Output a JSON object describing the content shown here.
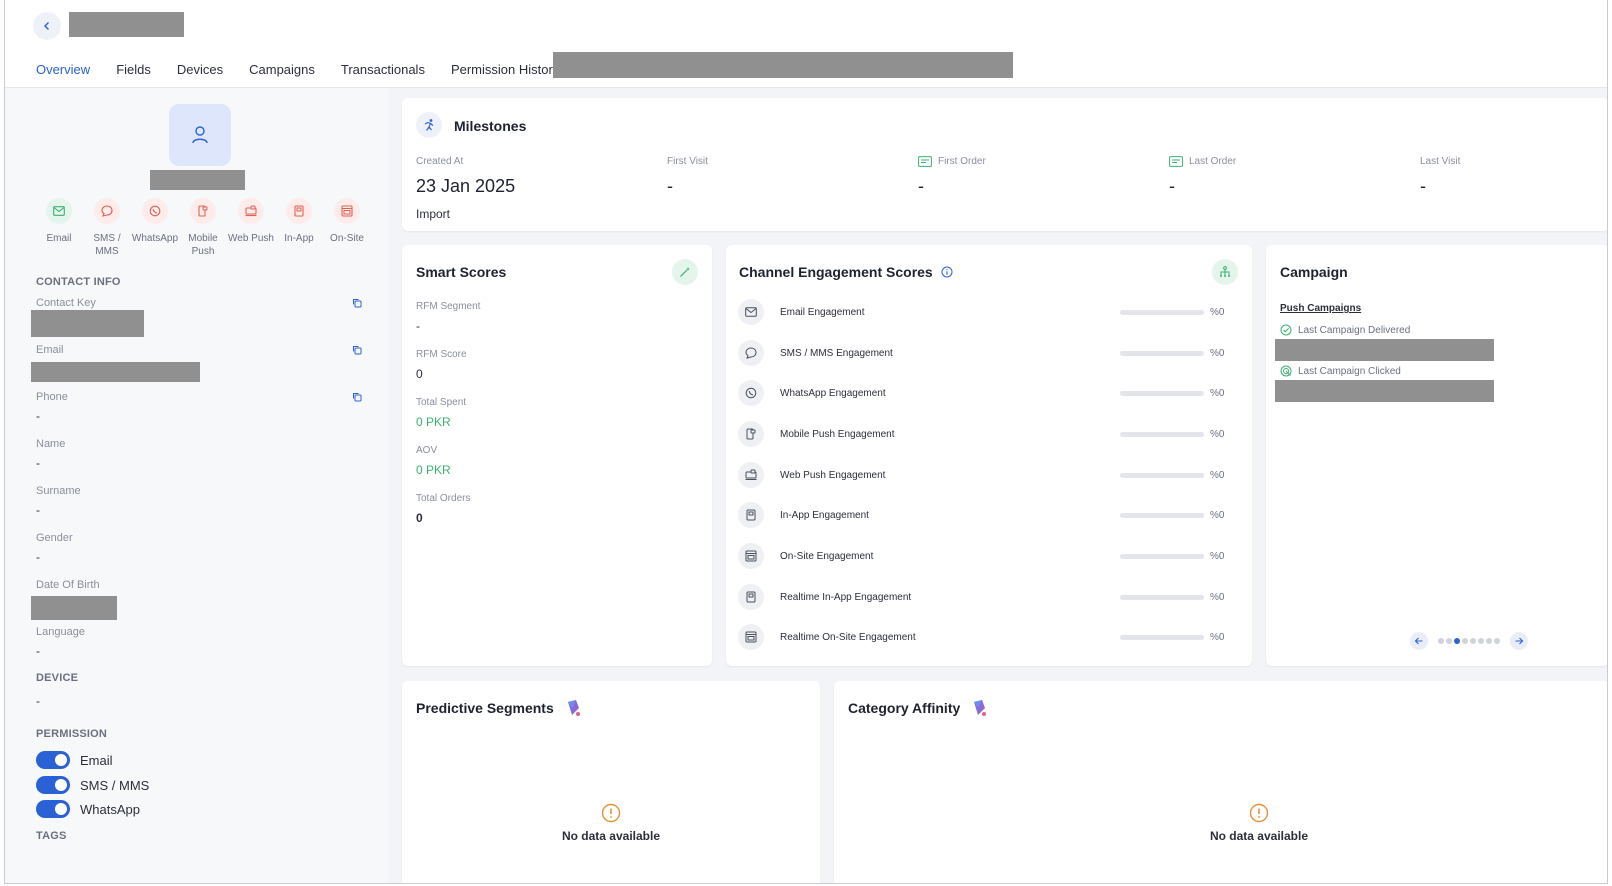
{
  "header": {
    "tabs": [
      {
        "label": "Overview",
        "active": true
      },
      {
        "label": "Fields"
      },
      {
        "label": "Devices"
      },
      {
        "label": "Campaigns"
      },
      {
        "label": "Transactionals"
      },
      {
        "label": "Permission History"
      }
    ]
  },
  "profile": {
    "channels": [
      {
        "label": "Email",
        "icon": "mail-icon",
        "color": "green"
      },
      {
        "label": "SMS / MMS",
        "icon": "chat-bubble-icon",
        "color": "red"
      },
      {
        "label": "WhatsApp",
        "icon": "whatsapp-icon",
        "color": "red"
      },
      {
        "label": "Mobile Push",
        "icon": "mobile-push-icon",
        "color": "red"
      },
      {
        "label": "Web Push",
        "icon": "web-push-icon",
        "color": "red"
      },
      {
        "label": "In-App",
        "icon": "in-app-icon",
        "color": "red"
      },
      {
        "label": "On-Site",
        "icon": "on-site-icon",
        "color": "red"
      }
    ],
    "contact_info_title": "CONTACT INFO",
    "fields": {
      "contact_key": "Contact Key",
      "email": "Email",
      "phone": "Phone",
      "phone_value": "-",
      "name": "Name",
      "name_value": "-",
      "surname": "Surname",
      "surname_value": "-",
      "gender": "Gender",
      "gender_value": "-",
      "dob": "Date Of Birth",
      "language": "Language",
      "language_value": "-"
    },
    "device_title": "DEVICE",
    "device_value": "-",
    "permission_title": "PERMISSION",
    "permissions": [
      {
        "label": "Email",
        "on": true
      },
      {
        "label": "SMS / MMS",
        "on": true
      },
      {
        "label": "WhatsApp",
        "on": true
      }
    ],
    "tags_title": "TAGS"
  },
  "milestones": {
    "title": "Milestones",
    "created_at_label": "Created At",
    "created_at_value": "23 Jan 2025",
    "created_at_source": "Import",
    "first_visit_label": "First Visit",
    "first_visit_value": "-",
    "first_order_label": "First Order",
    "first_order_value": "-",
    "last_order_label": "Last Order",
    "last_order_value": "-",
    "last_visit_label": "Last Visit",
    "last_visit_value": "-"
  },
  "smart_scores": {
    "title": "Smart Scores",
    "rfm_segment_label": "RFM Segment",
    "rfm_segment_value": "-",
    "rfm_score_label": "RFM Score",
    "rfm_score_value": "0",
    "total_spent_label": "Total Spent",
    "total_spent_value": "0 PKR",
    "aov_label": "AOV",
    "aov_value": "0 PKR",
    "total_orders_label": "Total Orders",
    "total_orders_value": "0"
  },
  "engagement": {
    "title": "Channel Engagement Scores",
    "rows": [
      {
        "label": "Email Engagement",
        "pct": "%0",
        "value": 0
      },
      {
        "label": "SMS / MMS Engagement",
        "pct": "%0",
        "value": 0
      },
      {
        "label": "WhatsApp Engagement",
        "pct": "%0",
        "value": 0
      },
      {
        "label": "Mobile Push Engagement",
        "pct": "%0",
        "value": 0
      },
      {
        "label": "Web Push Engagement",
        "pct": "%0",
        "value": 0
      },
      {
        "label": "In-App Engagement",
        "pct": "%0",
        "value": 0
      },
      {
        "label": "On-Site Engagement",
        "pct": "%0",
        "value": 0
      },
      {
        "label": "Realtime In-App Engagement",
        "pct": "%0",
        "value": 0
      },
      {
        "label": "Realtime On-Site Engagement",
        "pct": "%0",
        "value": 0
      }
    ]
  },
  "campaign": {
    "title": "Campaign",
    "link": "Push Campaigns",
    "delivered_label": "Last Campaign Delivered",
    "clicked_label": "Last Campaign Clicked",
    "pager_dots": 8,
    "pager_active": 2
  },
  "predictive": {
    "title": "Predictive Segments",
    "empty": "No data available"
  },
  "affinity": {
    "title": "Category Affinity",
    "empty": "No data available"
  },
  "colors": {
    "accent": "#2a62d6",
    "positive": "#3bb072",
    "channel_on": "#e4f5ec",
    "channel_off": "#fdecea",
    "warning": "#e8913a"
  }
}
